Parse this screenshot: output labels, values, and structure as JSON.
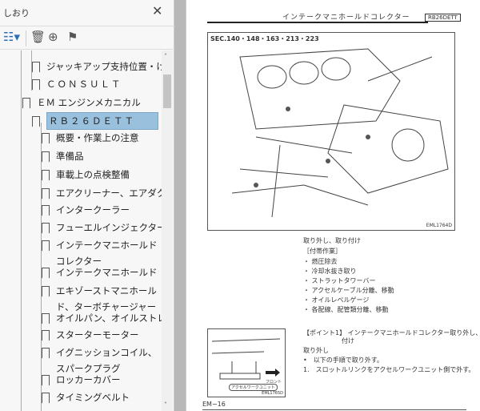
{
  "panel": {
    "title": "しおり",
    "close": "✕"
  },
  "tree": [
    {
      "label": "ジャッキアップ支持位置・けん引"
    },
    {
      "label": "ＣＯＮＳＵＬＴ"
    },
    {
      "label": "ＥＭ エンジンメカニカル"
    },
    {
      "label": "ＲＢ２６ＤＥＴＴ"
    },
    {
      "label": "概要・作業上の注意"
    },
    {
      "label": "準備品"
    },
    {
      "label": "車載上の点検整備"
    },
    {
      "label": "エアクリーナー、エアダクト"
    },
    {
      "label": "インタークーラー"
    },
    {
      "label": "フューエルインジェクター"
    },
    {
      "label": "インテークマニホールドコレクター"
    },
    {
      "label": "インテークマニホールド"
    },
    {
      "label": "エキゾーストマニホールド、ターボチャージャー"
    },
    {
      "label": "オイルパン、オイルストレーナー"
    },
    {
      "label": "スターターモーター"
    },
    {
      "label": "イグニッションコイル、スパークプラグ"
    },
    {
      "label": "ロッカーカバー"
    },
    {
      "label": "タイミングベルト"
    }
  ],
  "doc": {
    "title": "インテークマニホールドコレクター",
    "badge": "RB26DETT",
    "sec": "SEC.140・148・163・213・223",
    "fig1": "EML1764D",
    "fig2": "EML1765D",
    "fig2_label": "アクセルワークユニット",
    "fig2_front": "フロント",
    "heading": "取り外し、取り付け",
    "sub": "［付帯作業］",
    "tasks": [
      "・ 燃圧除去",
      "・ 冷却水抜き取り",
      "・ ストラットタワーバー",
      "・ アクセルケーブル分離、移動",
      "・ オイルレベルゲージ",
      "・ 各配線、配管類分離、移動"
    ],
    "point": "【ポイント1】 インテークマニホールドコレクター取り外し、取り",
    "point2": "付け",
    "removal": "取り外し",
    "step0": "•　以下の手順で取り外す。",
    "step1": "1.　スロットルリンクをアクセルワークユニット側で外す。",
    "page": "EM−16"
  }
}
